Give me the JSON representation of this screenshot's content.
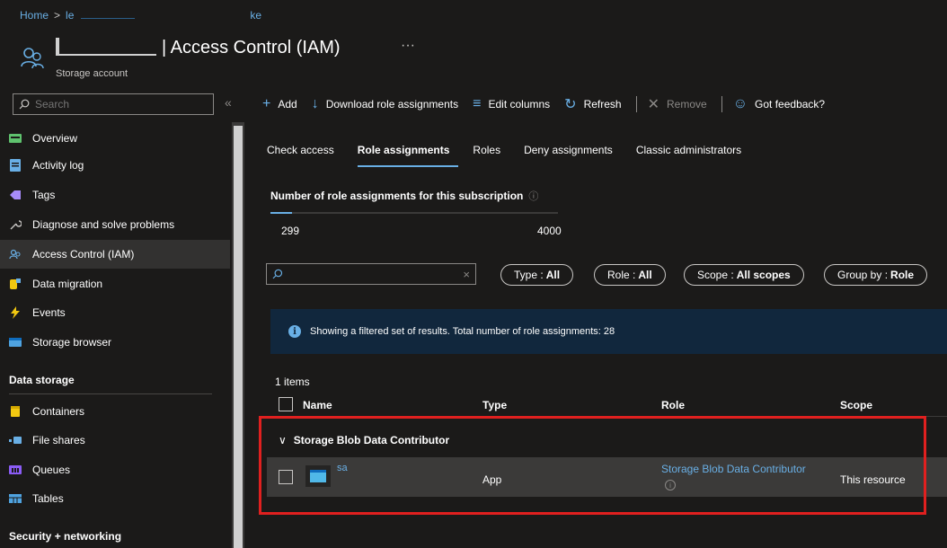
{
  "breadcrumb": {
    "home": "Home",
    "sep": ">",
    "item1": "le",
    "item2": "ke"
  },
  "header": {
    "title": "| Access Control (IAM)",
    "more": "···",
    "subtitle": "Storage account"
  },
  "sidebar": {
    "search_placeholder": "Search",
    "collapse": "«",
    "items": [
      {
        "label": "Overview",
        "icon": "overview-icon",
        "color": "#5fc26e"
      },
      {
        "label": "Activity log",
        "icon": "activity-log-icon",
        "color": "#69afe5"
      },
      {
        "label": "Tags",
        "icon": "tag-icon",
        "color": "#a78bfa"
      },
      {
        "label": "Diagnose and solve problems",
        "icon": "wrench-icon",
        "color": "#c8c6c4"
      },
      {
        "label": "Access Control (IAM)",
        "icon": "people-icon",
        "color": "#69afe5"
      },
      {
        "label": "Data migration",
        "icon": "data-migration-icon",
        "color": "#f2c811"
      },
      {
        "label": "Events",
        "icon": "lightning-icon",
        "color": "#f2c811"
      },
      {
        "label": "Storage browser",
        "icon": "storage-browser-icon",
        "color": "#4fa3e0"
      }
    ],
    "section_data_storage": "Data storage",
    "data_items": [
      {
        "label": "Containers",
        "icon": "container-icon",
        "color": "#f2c811"
      },
      {
        "label": "File shares",
        "icon": "file-share-icon",
        "color": "#69afe5"
      },
      {
        "label": "Queues",
        "icon": "queue-icon",
        "color": "#8b5cf6"
      },
      {
        "label": "Tables",
        "icon": "table-icon",
        "color": "#4fa3e0"
      }
    ],
    "section_security": "Security + networking"
  },
  "toolbar": {
    "add": "Add",
    "download": "Download role assignments",
    "edit_columns": "Edit columns",
    "refresh": "Refresh",
    "remove": "Remove",
    "feedback": "Got feedback?"
  },
  "tabs": [
    "Check access",
    "Role assignments",
    "Roles",
    "Deny assignments",
    "Classic administrators"
  ],
  "counter": {
    "label": "Number of role assignments for this subscription",
    "used": "299",
    "max": "4000",
    "fraction": 0.075
  },
  "filters": {
    "search_value": "",
    "type_label": "Type :",
    "type_value": "All",
    "role_label": "Role :",
    "role_value": "All",
    "scope_label": "Scope :",
    "scope_value": "All scopes",
    "group_label": "Group by :",
    "group_value": "Role"
  },
  "banner": {
    "text": "Showing a filtered set of results. Total number of role assignments: 28"
  },
  "table": {
    "items_count": "1 items",
    "headers": {
      "name": "Name",
      "type": "Type",
      "role": "Role",
      "scope": "Scope"
    },
    "group": "Storage Blob Data Contributor",
    "row": {
      "name": "sa",
      "type": "App",
      "role": "Storage Blob Data Contributor",
      "scope": "This resource"
    }
  },
  "colors": {
    "accent": "#69afe5",
    "highlight": "#e0201f",
    "background": "#1b1a19",
    "banner": "#11273d"
  }
}
